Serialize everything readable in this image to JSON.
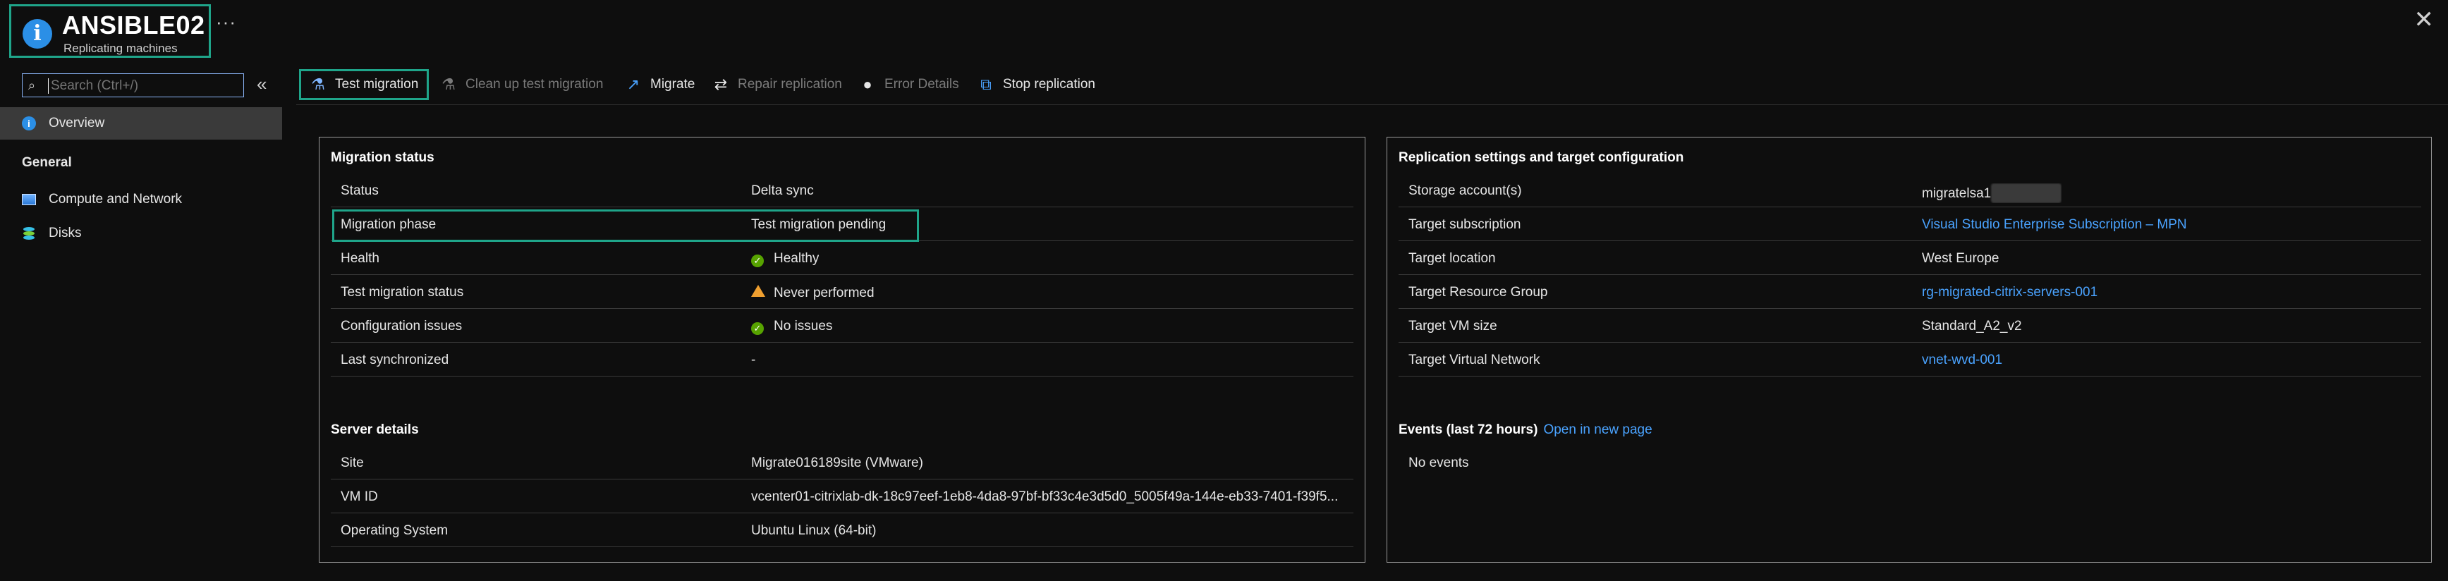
{
  "header": {
    "title": "ANSIBLE02",
    "subtitle": "Replicating machines",
    "more": "···",
    "close": "✕"
  },
  "sidebar": {
    "search_placeholder": "Search (Ctrl+/)",
    "collapse": "«",
    "items": [
      {
        "label": "Overview",
        "icon": "info-icon",
        "active": true
      },
      {
        "label": "Compute and Network",
        "icon": "monitor-icon"
      },
      {
        "label": "Disks",
        "icon": "disks-icon"
      }
    ],
    "section_general": "General"
  },
  "toolbar": {
    "buttons": [
      {
        "label": "Test migration",
        "icon": "flask-icon",
        "enabled": true,
        "highlighted": true
      },
      {
        "label": "Clean up test migration",
        "icon": "flask-clean-icon",
        "enabled": false
      },
      {
        "label": "Migrate",
        "icon": "migrate-icon",
        "enabled": true
      },
      {
        "label": "Repair replication",
        "icon": "repair-icon",
        "enabled": false
      },
      {
        "label": "Error Details",
        "icon": "error-icon",
        "enabled": false
      },
      {
        "label": "Stop replication",
        "icon": "stop-icon",
        "enabled": true
      }
    ]
  },
  "migration_status": {
    "title": "Migration status",
    "rows": [
      {
        "key": "Status",
        "value": "Delta sync"
      },
      {
        "key": "Migration phase",
        "value": "Test migration pending"
      },
      {
        "key": "Health",
        "value": "Healthy",
        "status": "ok"
      },
      {
        "key": "Test migration status",
        "value": "Never performed",
        "status": "warning"
      },
      {
        "key": "Configuration issues",
        "value": "No issues",
        "status": "ok"
      },
      {
        "key": "Last synchronized",
        "value": "-"
      }
    ]
  },
  "server_details": {
    "title": "Server details",
    "rows": [
      {
        "key": "Site",
        "value": "Migrate016189site (VMware)"
      },
      {
        "key": "VM ID",
        "value": "vcenter01-citrixlab-dk-18c97eef-1eb8-4da8-97bf-bf33c4e3d5d0_5005f49a-144e-eb33-7401-f39f5..."
      },
      {
        "key": "Operating System",
        "value": "Ubuntu Linux (64-bit)"
      }
    ]
  },
  "replication_settings": {
    "title": "Replication settings and target configuration",
    "rows": [
      {
        "key": "Storage account(s)",
        "value": "migratelsa1"
      },
      {
        "key": "Target subscription",
        "value": "Visual Studio Enterprise Subscription – MPN",
        "link": true
      },
      {
        "key": "Target location",
        "value": "West Europe"
      },
      {
        "key": "Target Resource Group",
        "value": "rg-migrated-citrix-servers-001",
        "link": true
      },
      {
        "key": "Target VM size",
        "value": "Standard_A2_v2"
      },
      {
        "key": "Target Virtual Network",
        "value": "vnet-wvd-001",
        "link": true
      }
    ]
  },
  "events": {
    "title": "Events (last 72 hours)",
    "link": "Open in new page",
    "empty": "No events"
  },
  "colors": {
    "accent_highlight": "#1fa58a",
    "link": "#4aa3ff",
    "ok": "#57a300",
    "warning": "#f0a030",
    "info": "#2b8fe6"
  }
}
